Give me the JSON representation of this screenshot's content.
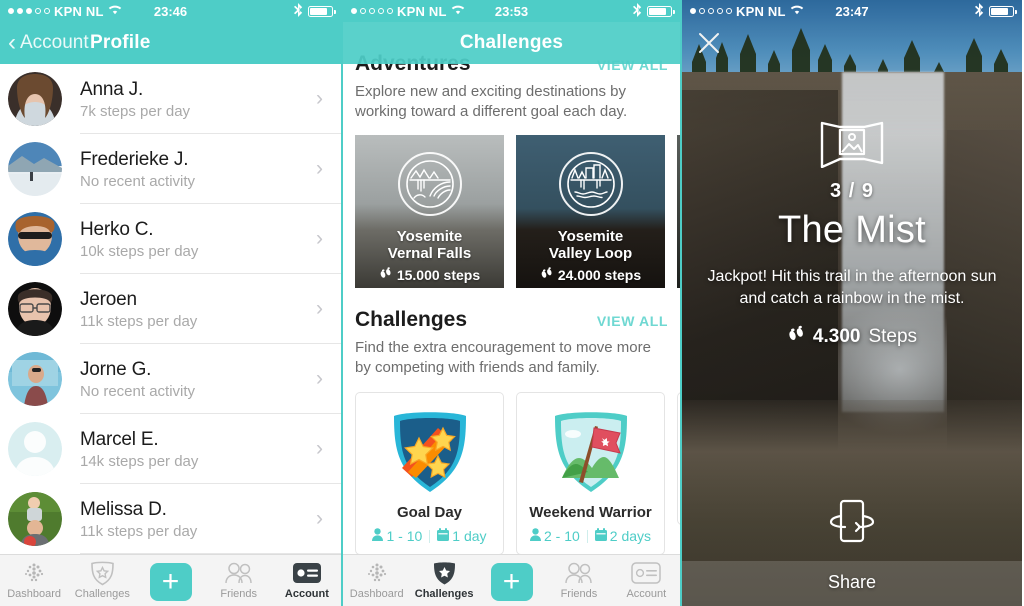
{
  "screens": {
    "profile": {
      "status": {
        "carrier": "KPN NL",
        "time": "23:46",
        "signal_dots_filled": 3,
        "signal_dots_total": 5
      },
      "nav": {
        "back_label": "Account",
        "title": "Profile"
      },
      "friends": [
        {
          "name": "Anna J.",
          "activity": "7k steps per day",
          "avatar": "photo-woman-smiling"
        },
        {
          "name": "Frederieke J.",
          "activity": "No recent activity",
          "avatar": "photo-snow-landscape"
        },
        {
          "name": "Herko C.",
          "activity": "10k steps per day",
          "avatar": "photo-man-sunglasses"
        },
        {
          "name": "Jeroen",
          "activity": "11k steps per day",
          "avatar": "photo-man-glasses"
        },
        {
          "name": "Jorne G.",
          "activity": "No recent activity",
          "avatar": "photo-man-outdoors"
        },
        {
          "name": "Marcel E.",
          "activity": "14k steps per day",
          "avatar": "default-silhouette"
        },
        {
          "name": "Melissa D.",
          "activity": "11k steps per day",
          "avatar": "photo-family-grass"
        }
      ],
      "tabs": [
        {
          "label": "Dashboard",
          "icon": "dashboard-dots-icon",
          "active": false
        },
        {
          "label": "Challenges",
          "icon": "shield-star-icon",
          "active": false
        },
        {
          "label": "",
          "icon": "plus-icon",
          "active": false
        },
        {
          "label": "Friends",
          "icon": "two-people-icon",
          "active": false
        },
        {
          "label": "Account",
          "icon": "id-card-icon",
          "active": true
        }
      ]
    },
    "challenges": {
      "status": {
        "carrier": "KPN NL",
        "time": "23:53",
        "signal_dots_filled": 1,
        "signal_dots_total": 5
      },
      "nav": {
        "title": "Challenges"
      },
      "adventures": {
        "title": "Adventures",
        "view_all": "VIEW ALL",
        "description": "Explore new and exciting destinations by working toward a different goal each day.",
        "cards": [
          {
            "name_line1": "Yosemite",
            "name_line2": "Vernal Falls",
            "steps": "15.000 steps",
            "icon": "waterfall-rainbow-badge-icon",
            "theme": "bg-vernal"
          },
          {
            "name_line1": "Yosemite",
            "name_line2": "Valley Loop",
            "steps": "24.000 steps",
            "icon": "valley-cliffs-badge-icon",
            "theme": "bg-valley"
          },
          {
            "name_line1": "",
            "name_line2": "",
            "steps": "",
            "icon": "",
            "theme": "bg-third"
          }
        ]
      },
      "challenges": {
        "title": "Challenges",
        "view_all": "VIEW ALL",
        "description": "Find the extra encouragement to move more by competing with friends and family.",
        "cards": [
          {
            "name": "Goal Day",
            "players": "1 - 10",
            "duration": "1 day",
            "badge": "shooting-stars-shield-icon"
          },
          {
            "name": "Weekend Warrior",
            "players": "2 - 10",
            "duration": "2 days",
            "badge": "red-flag-shield-icon"
          },
          {
            "name": "",
            "players": "",
            "duration": "",
            "badge": ""
          }
        ]
      },
      "tabs": [
        {
          "label": "Dashboard",
          "icon": "dashboard-dots-icon",
          "active": false
        },
        {
          "label": "Challenges",
          "icon": "shield-star-icon",
          "active": true
        },
        {
          "label": "",
          "icon": "plus-icon",
          "active": false
        },
        {
          "label": "Friends",
          "icon": "two-people-icon",
          "active": false
        },
        {
          "label": "Account",
          "icon": "id-card-icon",
          "active": false
        }
      ]
    },
    "adventure_detail": {
      "status": {
        "carrier": "KPN NL",
        "time": "23:47",
        "signal_dots_filled": 1,
        "signal_dots_total": 5
      },
      "close_icon": "close-icon",
      "pano_icon": "panorama-photo-icon",
      "counter": "3 / 9",
      "title": "The Mist",
      "description": "Jackpot! Hit this trail in the afternoon sun and catch a rainbow in the mist.",
      "steps_value": "4.300",
      "steps_unit": "Steps",
      "steps_icon": "footprints-icon",
      "share_icon": "share-rotate-phone-icon",
      "share_label": "Share"
    }
  },
  "colors": {
    "accent_teal": "#4ecdc7",
    "nav_teal": "#4ecdc7",
    "link_teal": "#6fd8d2",
    "text_dark": "#1c1c1c",
    "text_muted": "#a9a9a9",
    "tabbar_bg": "#f4f4f4"
  }
}
